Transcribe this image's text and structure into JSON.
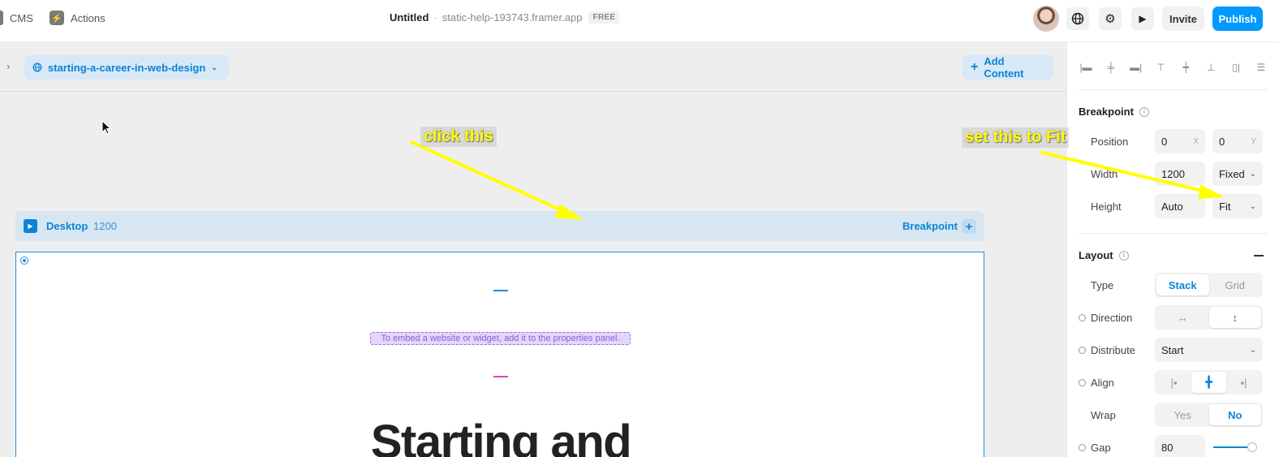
{
  "topbar": {
    "cms_label": "CMS",
    "actions_label": "Actions",
    "doc_name": "Untitled",
    "separator": "·",
    "doc_host": "static-help-193743.framer.app",
    "plan_badge": "FREE",
    "invite_label": "Invite",
    "publish_label": "Publish"
  },
  "canvas": {
    "page_name": "starting-a-career-in-web-design",
    "add_content_label": "Add Content",
    "breakpoint_bar": {
      "name": "Desktop",
      "width": "1200",
      "breakpoint_label": "Breakpoint",
      "add_symbol": "+"
    },
    "frame": {
      "embed_hint": "To embed a website or widget, add it to the properties panel.",
      "headline": "Starting and"
    }
  },
  "annotations": {
    "left": "click this",
    "right": "set this to Fit",
    "color": "#ffff00"
  },
  "panel": {
    "breakpoint": {
      "title": "Breakpoint",
      "position_label": "Position",
      "position_x": "0",
      "position_x_suffix": "X",
      "position_y": "0",
      "position_y_suffix": "Y",
      "width_label": "Width",
      "width_value": "1200",
      "width_mode": "Fixed",
      "height_label": "Height",
      "height_value": "Auto",
      "height_mode": "Fit"
    },
    "layout": {
      "title": "Layout",
      "type_label": "Type",
      "type_options": [
        "Stack",
        "Grid"
      ],
      "type_selected": "Stack",
      "direction_label": "Direction",
      "direction_options": [
        "↔",
        "↕"
      ],
      "distribute_label": "Distribute",
      "distribute_value": "Start",
      "align_label": "Align",
      "wrap_label": "Wrap",
      "wrap_options": [
        "Yes",
        "No"
      ],
      "wrap_selected": "No",
      "gap_label": "Gap",
      "gap_value": "80"
    }
  },
  "colors": {
    "accent": "#0099ff",
    "canvas_bg": "#eeeeee",
    "frame_border": "#1e90e0"
  }
}
